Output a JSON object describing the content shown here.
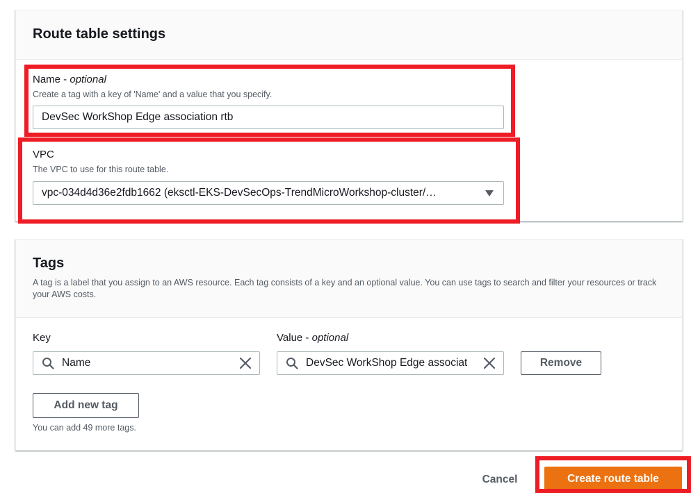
{
  "route_table_settings": {
    "title": "Route table settings",
    "name_field": {
      "label": "Name",
      "label_suffix": "optional",
      "description": "Create a tag with a key of 'Name' and a value that you specify.",
      "value": "DevSec WorkShop Edge association rtb"
    },
    "vpc_field": {
      "label": "VPC",
      "description": "The VPC to use for this route table.",
      "selected": "vpc-034d4d36e2fdb1662 (eksctl-EKS-DevSecOps-TrendMicroWorkshop-cluster/…"
    }
  },
  "tags": {
    "title": "Tags",
    "description": "A tag is a label that you assign to an AWS resource. Each tag consists of a key and an optional value. You can use tags to search and filter your resources or track your AWS costs.",
    "key_label": "Key",
    "value_label": "Value",
    "value_label_suffix": "optional",
    "rows": [
      {
        "key": "Name",
        "value": "DevSec WorkShop Edge associat",
        "remove_label": "Remove"
      }
    ],
    "add_label": "Add new tag",
    "limit_text": "You can add 49 more tags."
  },
  "footer": {
    "cancel_label": "Cancel",
    "create_label": "Create route table"
  },
  "colors": {
    "primary_orange": "#ec7211",
    "highlight_red": "#ee1c25",
    "text_dark": "#16191f",
    "text_secondary": "#545b64",
    "border": "#aab7b8"
  },
  "icons": [
    "search-icon",
    "close-icon",
    "caret-down-icon"
  ]
}
